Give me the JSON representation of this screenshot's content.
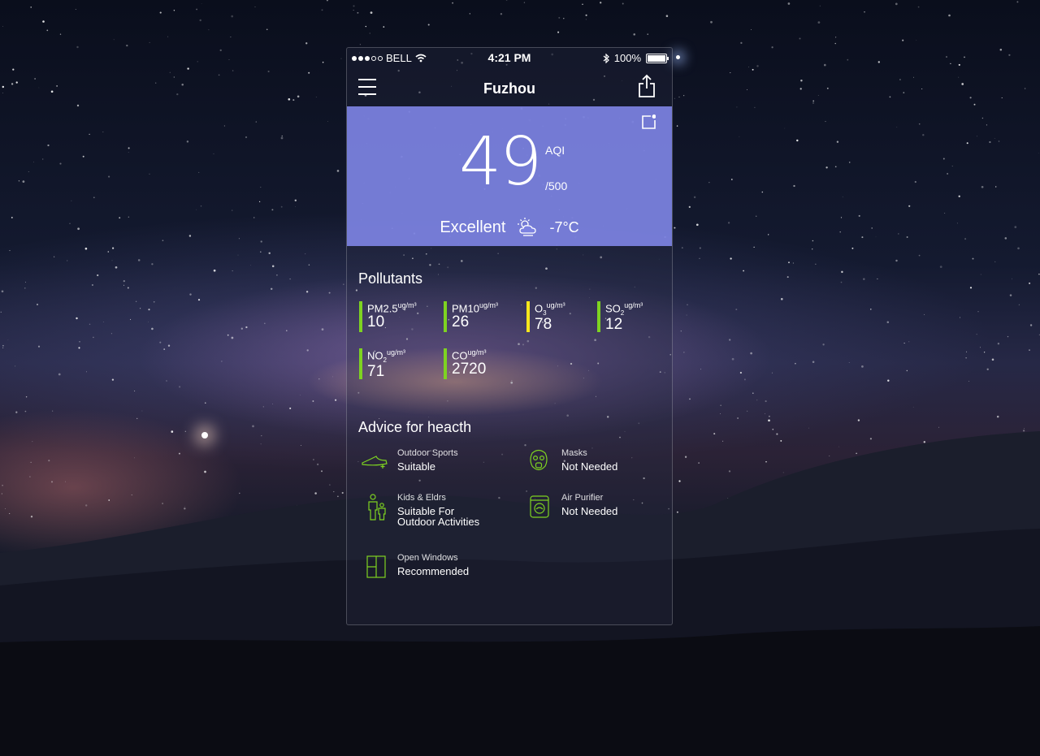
{
  "status": {
    "carrier": "BELL",
    "time": "4:21 PM",
    "battery": "100%"
  },
  "nav": {
    "title": "Fuzhou"
  },
  "aqi": {
    "value": "49",
    "label": "AQI",
    "max": "/500",
    "quality": "Excellent",
    "temperature": "-7°C"
  },
  "pollutants": {
    "title": "Pollutants",
    "items": [
      {
        "name": "PM2.5",
        "unit": "ug/m³",
        "value": "10",
        "color": "#7ed321"
      },
      {
        "name": "PM10",
        "unit": "ug/m³",
        "value": "26",
        "color": "#7ed321"
      },
      {
        "name": "O",
        "sub": "3",
        "unit": "ug/m³",
        "value": "78",
        "color": "#f8e71c"
      },
      {
        "name": "SO",
        "sub": "2",
        "unit": "ug/m³",
        "value": "12",
        "color": "#7ed321"
      },
      {
        "name": "NO",
        "sub": "2",
        "unit": "ug/m³",
        "value": "71",
        "color": "#7ed321"
      },
      {
        "name": "CO",
        "unit": "ug/m³",
        "value": "2720",
        "color": "#7ed321"
      }
    ]
  },
  "advice": {
    "title": "Advice for heacth",
    "items": [
      {
        "title": "Outdoor Sports",
        "value": "Suitable",
        "icon": "sneaker-icon"
      },
      {
        "title": "Masks",
        "value": "Not Needed",
        "icon": "gas-mask-icon"
      },
      {
        "title": "Kids & Eldrs",
        "value": "Suitable For Outdoor Activities",
        "value_line1": "Suitable For",
        "value_line2": "Outdoor Activities",
        "icon": "family-icon"
      },
      {
        "title": "Air Purifier",
        "value": "Not Needed",
        "icon": "air-purifier-icon"
      },
      {
        "title": "Open Windows",
        "value": "Recommended",
        "icon": "window-icon"
      }
    ]
  },
  "colors": {
    "accent_green": "#7ed321",
    "accent_yellow": "#f8e71c",
    "hero": "#7c82e1"
  }
}
